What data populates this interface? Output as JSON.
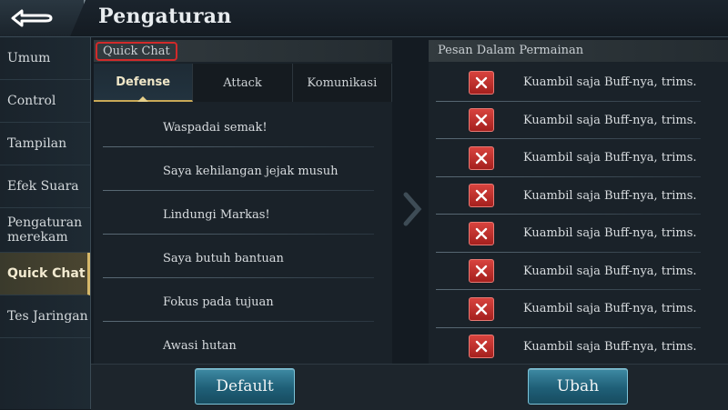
{
  "header": {
    "title": "Pengaturan"
  },
  "sidebar": {
    "items": [
      {
        "label": "Umum"
      },
      {
        "label": "Control"
      },
      {
        "label": "Tampilan"
      },
      {
        "label": "Efek Suara"
      },
      {
        "label": "Pengaturan merekam"
      },
      {
        "label": "Quick Chat"
      },
      {
        "label": "Tes Jaringan"
      }
    ],
    "active": "Quick Chat"
  },
  "left_panel": {
    "section_label": "Quick Chat",
    "tabs": [
      {
        "label": "Defense"
      },
      {
        "label": "Attack"
      },
      {
        "label": "Komunikasi"
      }
    ],
    "active_tab": "Defense",
    "messages": [
      "Waspadai semak!",
      "Saya kehilangan jejak musuh",
      "Lindungi Markas!",
      "Saya butuh bantuan",
      "Fokus pada tujuan",
      "Awasi hutan"
    ]
  },
  "right_panel": {
    "section_label": "Pesan Dalam Permainan",
    "slots": [
      "Kuambil saja Buff-nya, trims.",
      "Kuambil saja Buff-nya, trims.",
      "Kuambil saja Buff-nya, trims.",
      "Kuambil saja Buff-nya, trims.",
      "Kuambil saja Buff-nya, trims.",
      "Kuambil saja Buff-nya, trims.",
      "Kuambil saja Buff-nya, trims.",
      "Kuambil saja Buff-nya, trims."
    ]
  },
  "buttons": {
    "default_label": "Default",
    "change_label": "Ubah"
  },
  "colors": {
    "accent_gold": "#d6b86a",
    "highlight_red": "#d12a2a",
    "button_teal": "#1f5f77",
    "remove_red": "#c0302b"
  },
  "icons": {
    "back": "back-arrow-icon",
    "next": "chevron-right-icon",
    "remove": "close-icon"
  }
}
